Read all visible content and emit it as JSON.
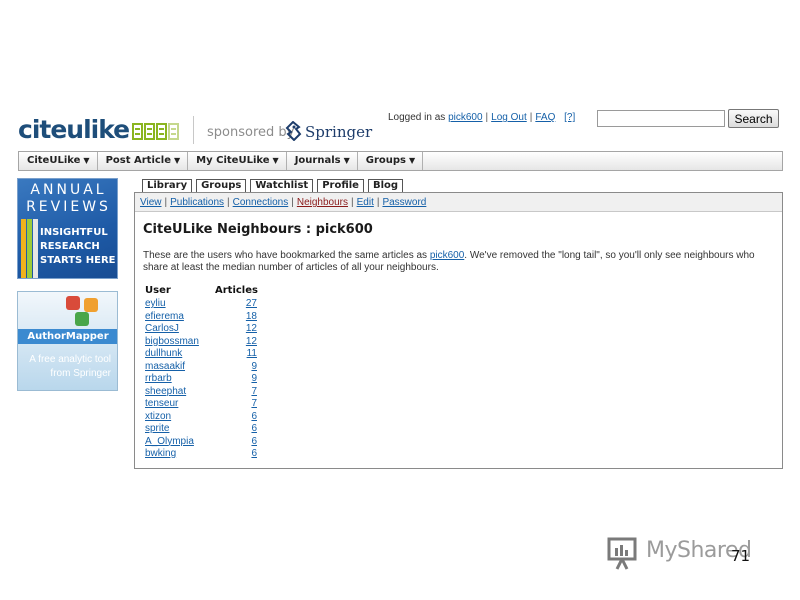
{
  "header": {
    "logo_text": "citeulike",
    "sponsored_by": "sponsored by",
    "sponsor_name": "Springer",
    "logged_in_prefix": "Logged in as",
    "username": "pick600",
    "logout": "Log Out",
    "faq": "FAQ",
    "help": "[?]",
    "search_value": "",
    "search_button": "Search"
  },
  "menu": [
    {
      "label": "CiteULike"
    },
    {
      "label": "Post Article"
    },
    {
      "label": "My CiteULike"
    },
    {
      "label": "Journals"
    },
    {
      "label": "Groups"
    }
  ],
  "banners": {
    "annual": {
      "line1": "ANNUAL",
      "line2": "REVIEWS",
      "line3": "INSIGHTFUL",
      "line4": "RESEARCH",
      "line5": "STARTS HERE"
    },
    "author": {
      "title": "AuthorMapper",
      "line1": "A free analytic tool",
      "line2": "from Springer"
    }
  },
  "tabs": [
    {
      "label": "Library"
    },
    {
      "label": "Groups"
    },
    {
      "label": "Watchlist"
    },
    {
      "label": "Profile"
    },
    {
      "label": "Blog"
    }
  ],
  "subnav": [
    {
      "label": "View"
    },
    {
      "label": "Publications"
    },
    {
      "label": "Connections"
    },
    {
      "label": "Neighbours"
    },
    {
      "label": "Edit"
    },
    {
      "label": "Password"
    }
  ],
  "page": {
    "title": "CiteULike Neighbours : pick600",
    "intro_before": "These are the users who have bookmarked the same articles as ",
    "intro_link": "pick600",
    "intro_after": ". We've removed the \"long tail\", so you'll only see neighbours who share at least the median number of articles of all your neighbours."
  },
  "table": {
    "headers": {
      "user": "User",
      "articles": "Articles"
    },
    "rows": [
      {
        "user": "eyliu",
        "articles": "27"
      },
      {
        "user": "efierema",
        "articles": "18"
      },
      {
        "user": "CarlosJ",
        "articles": "12"
      },
      {
        "user": "bigbossman",
        "articles": "12"
      },
      {
        "user": "dullhunk",
        "articles": "11"
      },
      {
        "user": "masaakif",
        "articles": "9"
      },
      {
        "user": "rrbarb",
        "articles": "9"
      },
      {
        "user": "sheephat",
        "articles": "7"
      },
      {
        "user": "tenseur",
        "articles": "7"
      },
      {
        "user": "xtizon",
        "articles": "6"
      },
      {
        "user": "sprite",
        "articles": "6"
      },
      {
        "user": "A_Olympia",
        "articles": "6"
      },
      {
        "user": "bwking",
        "articles": "6"
      }
    ]
  },
  "watermark": {
    "brand": "MyShared",
    "page_number": "71"
  },
  "colors": {
    "brand_blue": "#1e4e7a",
    "logo_green": "#8bb520",
    "link": "#1560a8",
    "current_subnav": "#8a1a1a"
  }
}
